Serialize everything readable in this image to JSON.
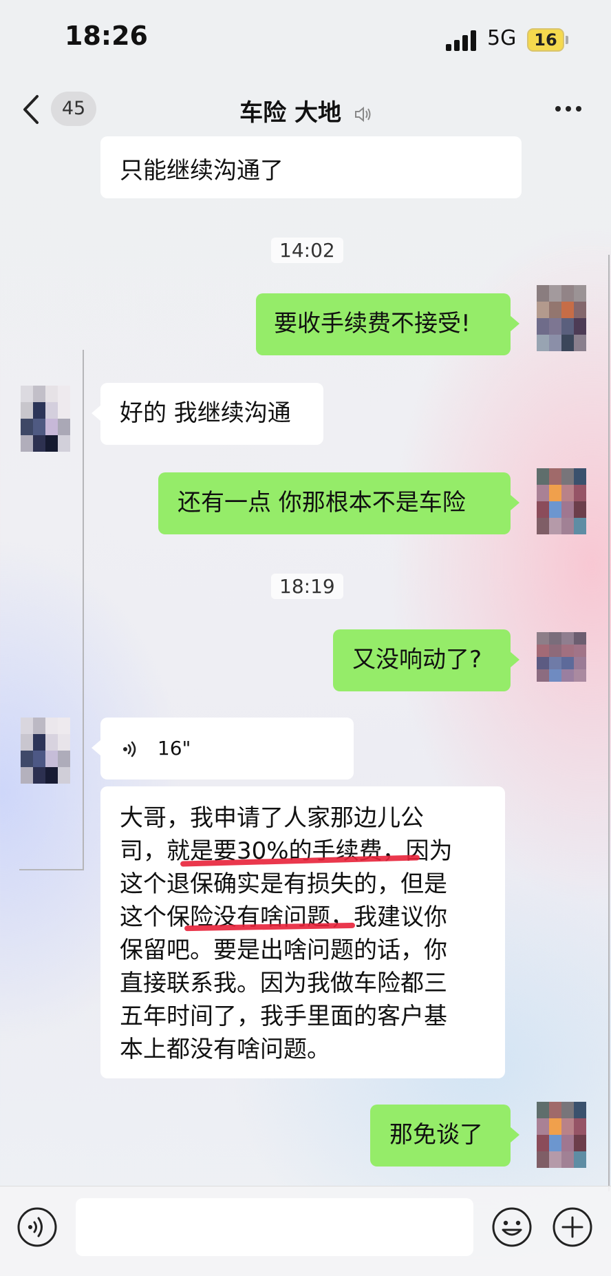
{
  "status_bar": {
    "time": "18:26",
    "network": "5G",
    "battery": "16"
  },
  "nav": {
    "unread_count": "45",
    "title": "车险 大地"
  },
  "messages": {
    "m0": "只能继续沟通了",
    "t1": "14:02",
    "m1": "要收手续费不接受!",
    "m2": "好的 我继续沟通",
    "m3": "还有一点 你那根本不是车险",
    "t2": "18:19",
    "m4": "又没响动了?",
    "voice_duration": "16\"",
    "m5_lines": [
      "大哥，我申请了人家那边儿公",
      "司，就是要30%的手续费，因为",
      "这个退保确实是有损失的，但是",
      "这个保险没有啥问题，我建议你",
      "保留吧。要是出啥问题的话，你",
      "直接联系我。因为我做车险都三",
      "五年时间了，我手里面的客户基",
      "本上都没有啥问题。"
    ],
    "m6": "那免谈了"
  },
  "input": {
    "placeholder": ""
  },
  "icons": {
    "back": "chevron-left-icon",
    "mute": "mute-icon",
    "more": "more-dots-icon",
    "voice": "voice-wave-icon",
    "emoji": "emoji-icon",
    "plus": "plus-circle-icon"
  },
  "colors": {
    "sent_bubble": "#95ec69",
    "received_bubble": "#ffffff",
    "underline": "#e8223a"
  }
}
